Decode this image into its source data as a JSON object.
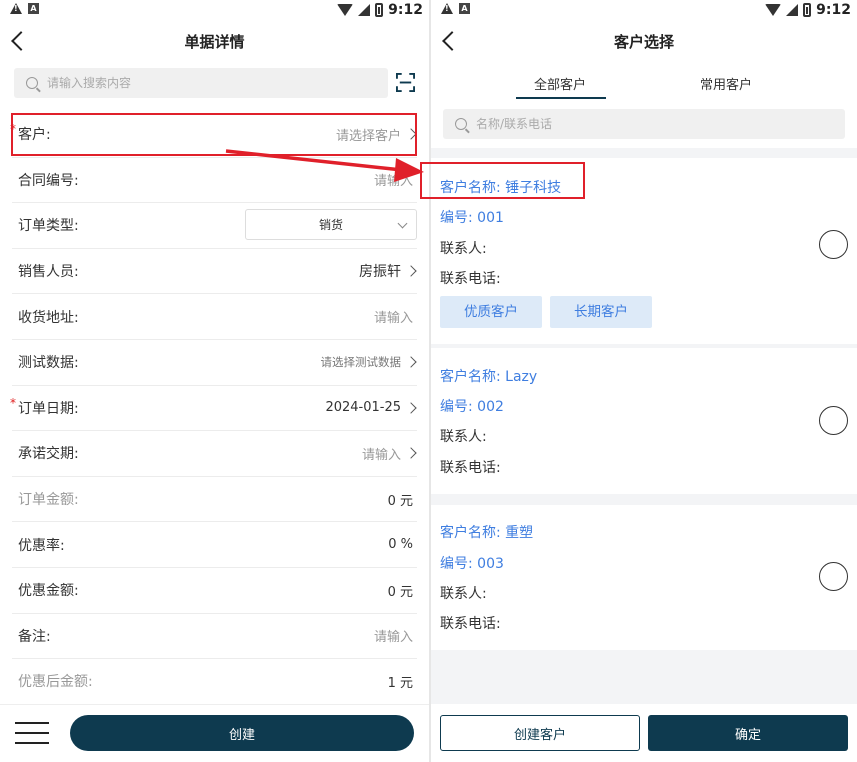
{
  "status_bar": {
    "time": "9:12"
  },
  "left": {
    "title": "单据详情",
    "search_placeholder": "请输入搜索内容",
    "fields": [
      {
        "label": "客户:",
        "value": "请选择客户",
        "required": true
      },
      {
        "label": "合同编号:",
        "value": "请输入"
      },
      {
        "label": "订单类型:",
        "value": "销货"
      },
      {
        "label": "销售人员:",
        "value": "房振轩"
      },
      {
        "label": "收货地址:",
        "value": "请输入"
      },
      {
        "label": "测试数据:",
        "value": "请选择测试数据"
      },
      {
        "label": "订单日期:",
        "value": "2024-01-25",
        "required": true
      },
      {
        "label": "承诺交期:",
        "value": "请输入"
      },
      {
        "label": "订单金额:",
        "value": "0 元"
      },
      {
        "label": "优惠率:",
        "value": "0 %"
      },
      {
        "label": "优惠金额:",
        "value": "0 元"
      },
      {
        "label": "备注:",
        "value": "请输入"
      },
      {
        "label": "优惠后金额:",
        "value": "1 元"
      }
    ],
    "create_label": "创建"
  },
  "right": {
    "title": "客户选择",
    "tabs": [
      "全部客户",
      "常用客户"
    ],
    "search_placeholder": "名称/联系电话",
    "customers": [
      {
        "name": "客户名称: 锤子科技",
        "code": "编号: 001",
        "contact": "联系人:",
        "phone": "联系电话:",
        "tags": [
          "优质客户",
          "长期客户"
        ]
      },
      {
        "name": "客户名称: Lazy",
        "code": "编号: 002",
        "contact": "联系人:",
        "phone": "联系电话:"
      },
      {
        "name": "客户名称: 重塑",
        "code": "编号: 003",
        "contact": "联系人:",
        "phone": "联系电话:"
      }
    ],
    "create_customer_label": "创建客户",
    "confirm_label": "确定"
  },
  "colors": {
    "primary": "#0e3a4f",
    "link": "#3f7ee0",
    "highlight": "#e0202a"
  }
}
